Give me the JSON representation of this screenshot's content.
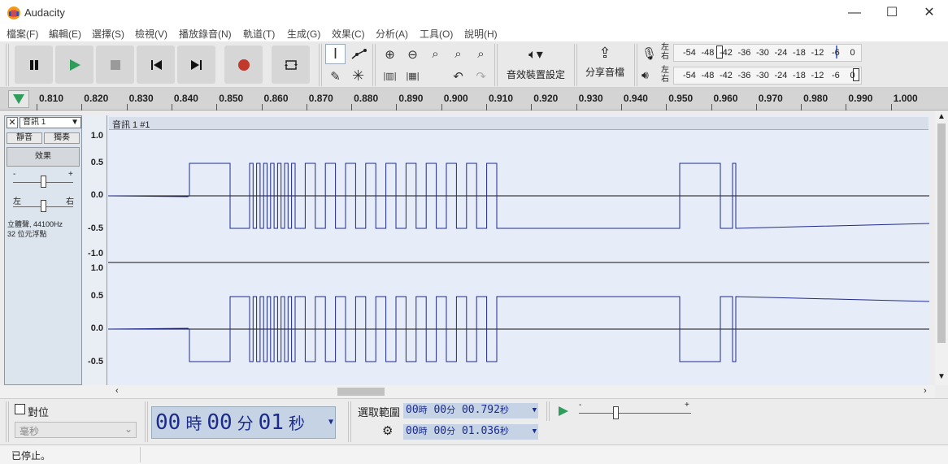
{
  "window": {
    "title": "Audacity",
    "minimize": "—",
    "maximize": "☐",
    "close": "✕"
  },
  "menu": [
    "檔案(F)",
    "編輯(E)",
    "選擇(S)",
    "檢視(V)",
    "播放錄音(N)",
    "軌道(T)",
    "生成(G)",
    "效果(C)",
    "分析(A)",
    "工具(O)",
    "說明(H)"
  ],
  "toolbar": {
    "audio_setup_label": "音效裝置設定",
    "share_audio_label": "分享音檔",
    "meter_lr": "左\n右",
    "meter_scale": [
      "-54",
      "-48",
      "-42",
      "-36",
      "-30",
      "-24",
      "-18",
      "-12",
      "-6",
      "0"
    ]
  },
  "ruler": {
    "ticks": [
      "0.810",
      "0.820",
      "0.830",
      "0.840",
      "0.850",
      "0.860",
      "0.870",
      "0.880",
      "0.890",
      "0.900",
      "0.910",
      "0.920",
      "0.930",
      "0.940",
      "0.950",
      "0.960",
      "0.970",
      "0.980",
      "0.990",
      "1.000"
    ]
  },
  "track": {
    "name": "音訊 1",
    "clip_name": "音訊 1 #1",
    "mute_label": "靜音",
    "solo_label": "獨奏",
    "effects_label": "效果",
    "gain_min": "-",
    "gain_max": "+",
    "pan_left": "左",
    "pan_right": "右",
    "info_line1": "立體聲, 44100Hz",
    "info_line2": "32 位元浮點",
    "vscale_top": [
      "1.0",
      "0.5",
      "0.0",
      "-0.5",
      "-1.0"
    ],
    "vscale_bottom": [
      "1.0",
      "0.5",
      "0.0",
      "-0.5"
    ]
  },
  "bottom": {
    "snap_label": "對位",
    "snap_unit": "毫秒",
    "time": {
      "h": "00",
      "h_unit": "時",
      "m": "00",
      "m_unit": "分",
      "s": "01",
      "s_unit": "秒"
    },
    "selection_label": "選取範圍",
    "sel_start": {
      "h": "00",
      "h_unit": "時",
      "m": "00",
      "m_unit": "分",
      "s": "00.792",
      "s_unit": "秒"
    },
    "sel_end": {
      "h": "00",
      "h_unit": "時",
      "m": "00",
      "m_unit": "分",
      "s": "01.036",
      "s_unit": "秒"
    },
    "speed_min": "-",
    "speed_max": "+"
  },
  "status": "已停止。",
  "colors": {
    "accent_play": "#2f9e5b",
    "record": "#c0392b",
    "wave": "#1f2a8c",
    "track_bg": "#e6ecf8"
  }
}
